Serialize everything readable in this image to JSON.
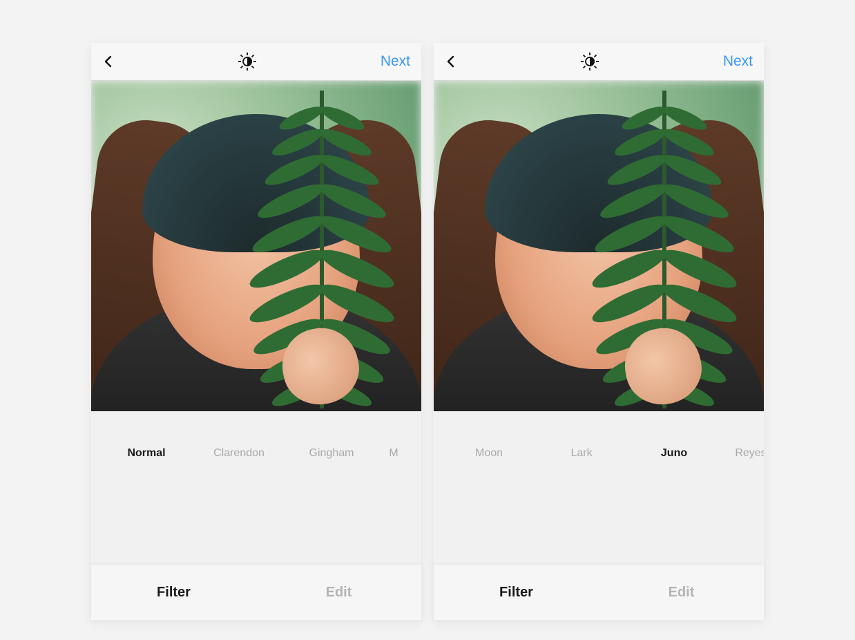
{
  "colors": {
    "accent": "#3897f0"
  },
  "panes": [
    {
      "nav": {
        "next": "Next"
      },
      "previewFilter": "normal",
      "filters": [
        {
          "key": "normal",
          "label": "Normal",
          "active": true
        },
        {
          "key": "clarendon",
          "label": "Clarendon",
          "active": false
        },
        {
          "key": "gingham",
          "label": "Gingham",
          "active": false
        },
        {
          "key": "moon",
          "label": "M",
          "active": false,
          "partial": true
        }
      ],
      "tabs": {
        "filter": "Filter",
        "edit": "Edit",
        "active": "filter"
      }
    },
    {
      "nav": {
        "next": "Next"
      },
      "previewFilter": "juno",
      "filters": [
        {
          "key": "moon",
          "label": "Moon",
          "active": false
        },
        {
          "key": "lark",
          "label": "Lark",
          "active": false
        },
        {
          "key": "juno",
          "label": "Juno",
          "active": true
        },
        {
          "key": "reyes",
          "label": "Reyes",
          "active": false,
          "partial2": true
        }
      ],
      "tabs": {
        "filter": "Filter",
        "edit": "Edit",
        "active": "filter"
      }
    }
  ]
}
